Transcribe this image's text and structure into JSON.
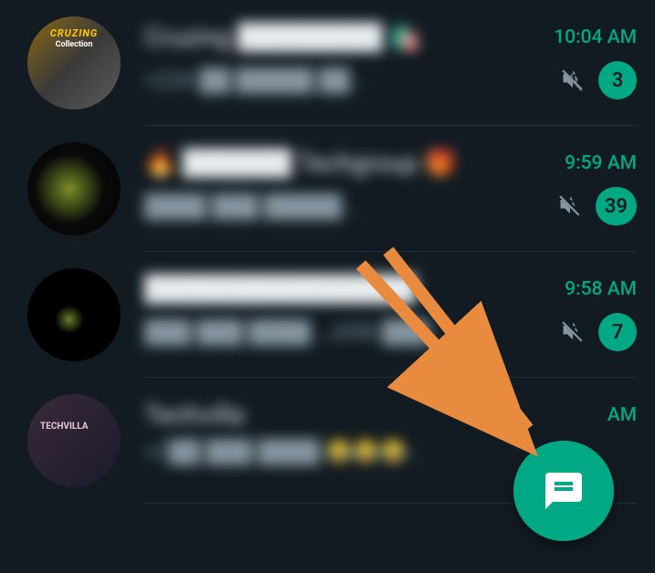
{
  "chats": [
    {
      "title": "Cruzing ████████ 🛍️",
      "snippet": "+234 ██ █████ ██...",
      "time": "10:04 AM",
      "muted": true,
      "unread": "3",
      "avatar_label": "CRUZING Collection"
    },
    {
      "title": "🔥 ██████ Techgroup 🎁",
      "snippet": "████ ███ █████...",
      "time": "9:59 AM",
      "muted": true,
      "unread": "39",
      "avatar_label": ""
    },
    {
      "title": "███████████████",
      "snippet": "███ ███ ████...JOIN ███...",
      "time": "9:58 AM",
      "muted": true,
      "unread": "7",
      "avatar_label": ""
    },
    {
      "title": "Techvilla",
      "snippet": "+2██ ███ ████ 😂😂😂...",
      "time": "AM",
      "muted": false,
      "unread": "",
      "avatar_label": "TECHVILLA"
    }
  ],
  "colors": {
    "background": "#121b22",
    "accent": "#00a884",
    "text_primary": "#e9edef",
    "text_secondary": "#8696a0",
    "annotation_arrow": "#e88b3e"
  },
  "fab_icon": "new-chat"
}
